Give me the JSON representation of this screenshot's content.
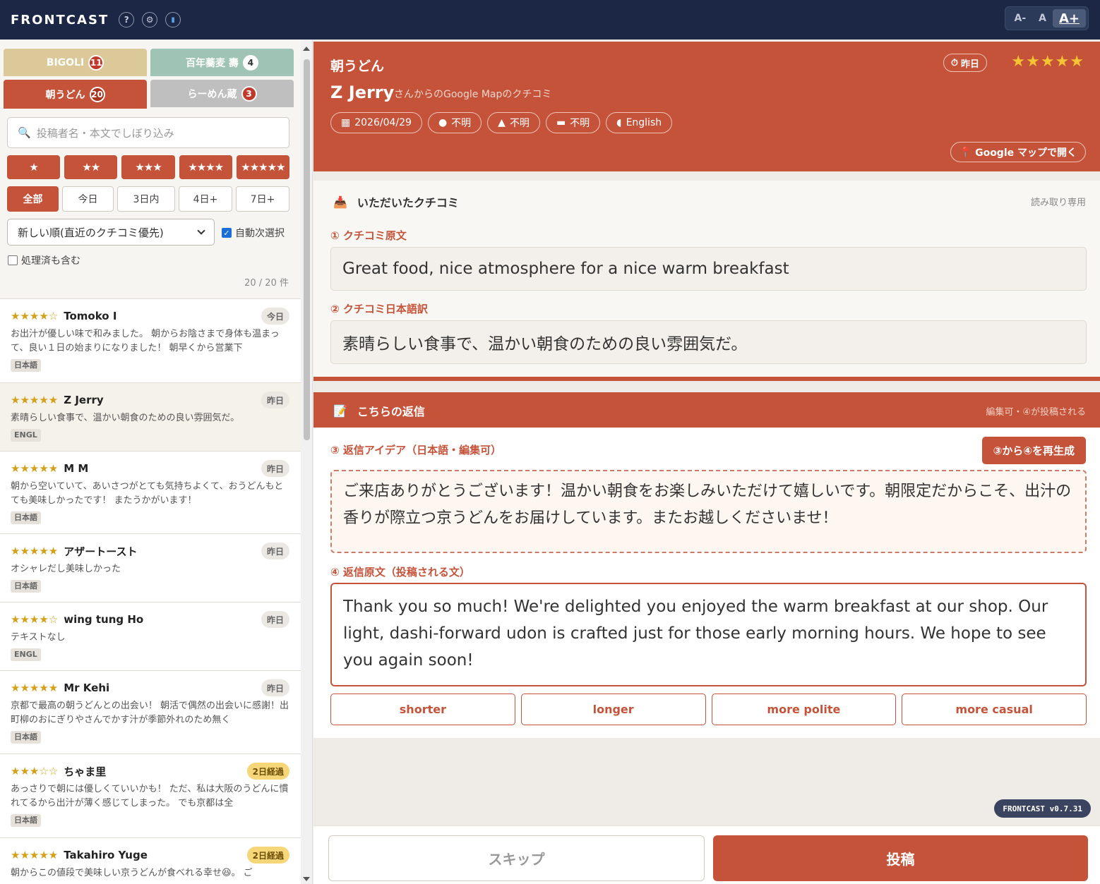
{
  "app": {
    "brand": "FRONTCAST",
    "icons": [
      "help-icon",
      "gear-icon",
      "chart-icon"
    ],
    "font_size": {
      "small": "A-",
      "normal": "A",
      "large": "A+"
    },
    "version": "FRONTCAST v0.7.31"
  },
  "sidebar": {
    "shops": [
      {
        "name": "BIGOLI",
        "count": "11"
      },
      {
        "name": "百年蕎麦 壽",
        "count": "4"
      },
      {
        "name": "朝うどん",
        "count": "20"
      },
      {
        "name": "らーめん蔵",
        "count": "3"
      }
    ],
    "search_placeholder": "投稿者名・本文でしぼり込み",
    "star_filters": [
      "★",
      "★★",
      "★★★",
      "★★★★",
      "★★★★★"
    ],
    "day_filters": [
      "全部",
      "今日",
      "3日内",
      "4日+",
      "7日+"
    ],
    "sort_value": "新しい順(直近のクチコミ優先)",
    "auto_next_label": "自動次選択",
    "include_processed_label": "処理済も含む",
    "count_text": "20 / 20 件",
    "reviews": [
      {
        "stars": "★★★★☆",
        "name": "Tomoko I",
        "badge": "今日",
        "text": "お出汁が優しい味で和みました。 朝からお陰さまで身体も温まって、良い１日の始まりになりました！ 朝早くから営業下",
        "lang": "日本語"
      },
      {
        "stars": "★★★★★",
        "name": "Z Jerry",
        "badge": "昨日",
        "text": "素晴らしい食事で、温かい朝食のための良い雰囲気だ。",
        "lang": "ENGL"
      },
      {
        "stars": "★★★★★",
        "name": "M M",
        "badge": "昨日",
        "text": "朝から空いていて、あいさつがとても気持ちよくて、おうどんもとても美味しかったです！ またうかがいます！",
        "lang": "日本語"
      },
      {
        "stars": "★★★★★",
        "name": "アザートースト",
        "badge": "昨日",
        "text": "オシャレだし美味しかった",
        "lang": "日本語"
      },
      {
        "stars": "★★★★☆",
        "name": "wing tung Ho",
        "badge": "昨日",
        "text": "テキストなし",
        "lang": "ENGL"
      },
      {
        "stars": "★★★★★",
        "name": "Mr Kehi",
        "badge": "昨日",
        "text": "京都で最高の朝うどんとの出会い！ 朝活で偶然の出会いに感謝！出町柳のおにぎりやさんでかす汁が季節外れのため無く",
        "lang": "日本語"
      },
      {
        "stars": "★★★☆☆",
        "name": "ちゃま里",
        "badge": "2日経過",
        "text": "あっさりで朝には優しくていいかも！ ただ、私は大阪のうどんに慣れてるから出汁が薄く感じてしまった。 でも京都は全",
        "lang": "日本語"
      },
      {
        "stars": "★★★★★",
        "name": "Takahiro Yuge",
        "badge": "2日経過",
        "text": "朝からこの値段で美味しい京うどんが食べれる幸せ😆。 ご",
        "lang": ""
      }
    ]
  },
  "review": {
    "shop": "朝うどん",
    "when": "昨日",
    "stars": "★★★★★",
    "author": "Z Jerry",
    "author_suffix": "さんからのGoogle Mapのクチコミ",
    "chips": [
      {
        "icon": "calendar-icon",
        "label": "2026/04/29"
      },
      {
        "icon": "globe-icon",
        "label": "不明"
      },
      {
        "icon": "person-icon",
        "label": "不明"
      },
      {
        "icon": "cake-icon",
        "label": "不明"
      },
      {
        "icon": "speech-icon",
        "label": "English"
      }
    ],
    "map_button": "Google マップで開く"
  },
  "received": {
    "title": "いただいたクチコミ",
    "note": "読み取り専用",
    "original_label": "① クチコミ原文",
    "original_text": "Great food, nice atmosphere for a nice warm breakfast",
    "translation_label": "② クチコミ日本語訳",
    "translation_text": "素晴らしい食事で、温かい朝食のための良い雰囲気だ。"
  },
  "reply": {
    "title": "こちらの返信",
    "note": "編集可・④が投稿される",
    "idea_label": "③ 返信アイデア（日本語・編集可）",
    "regen_button": "③から④を再生成",
    "idea_text": "ご来店ありがとうございます！温かい朝食をお楽しみいただけて嬉しいです。朝限定だからこそ、出汁の香りが際立つ京うどんをお届けしています。またお越しくださいませ！",
    "original_label": "④ 返信原文（投稿される文）",
    "original_text": "Thank you so much! We're delighted you enjoyed the warm breakfast at our shop. Our light, dashi-forward udon is crafted just for those early morning hours. We hope to see you again soon!",
    "tones": [
      "shorter",
      "longer",
      "more polite",
      "more casual"
    ]
  },
  "footer": {
    "skip": "スキップ",
    "post": "投稿"
  },
  "colors": {
    "accent": "#c5533a",
    "topbar": "#1b2744",
    "star": "#d4a017"
  }
}
